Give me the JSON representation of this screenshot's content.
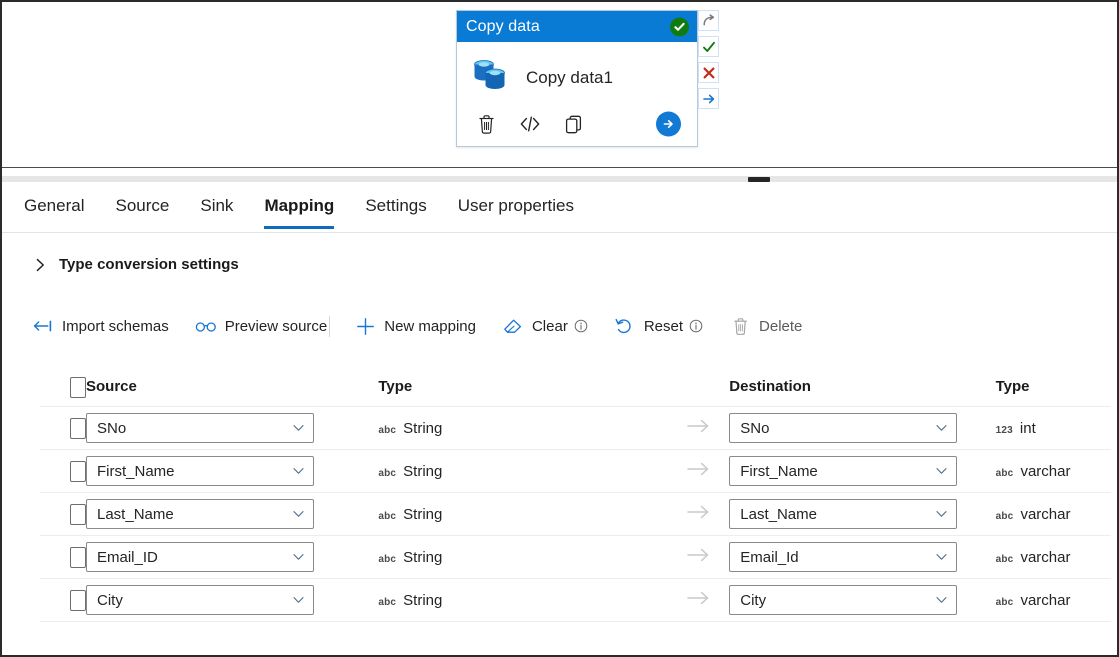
{
  "canvas": {
    "activity_card": {
      "header_title": "Copy data",
      "status_icon": "check-circle-icon",
      "activity_name": "Copy data1",
      "activity_icon": "copy-data-database-icon",
      "actions": [
        {
          "name": "delete-activity-button",
          "icon": "trash-icon"
        },
        {
          "name": "code-view-button",
          "icon": "code-brackets-icon"
        },
        {
          "name": "clone-activity-button",
          "icon": "duplicate-icon"
        },
        {
          "name": "run-activity-button",
          "icon": "arrow-right-circle-icon"
        }
      ]
    },
    "dependency_rail": [
      {
        "name": "dependency-skipped",
        "icon": "skip-arrow-icon",
        "color": "#7a7a7a"
      },
      {
        "name": "dependency-success",
        "icon": "check-icon",
        "color": "#107c10"
      },
      {
        "name": "dependency-failure",
        "icon": "cross-icon",
        "color": "#c42b1c"
      },
      {
        "name": "dependency-completion",
        "icon": "arrow-right-icon",
        "color": "#0f6cbd"
      }
    ]
  },
  "tabs": [
    {
      "label": "General",
      "active": false
    },
    {
      "label": "Source",
      "active": false
    },
    {
      "label": "Sink",
      "active": false
    },
    {
      "label": "Mapping",
      "active": true
    },
    {
      "label": "Settings",
      "active": false
    },
    {
      "label": "User properties",
      "active": false
    }
  ],
  "type_conversion": {
    "label": "Type conversion settings",
    "expanded": false,
    "chevron_icon": "chevron-right-icon"
  },
  "commandbar": [
    {
      "label": "Import schemas",
      "icon": "import-schemas-icon",
      "info": false
    },
    {
      "label": "Preview source",
      "icon": "glasses-icon",
      "info": false
    },
    {
      "label": "New mapping",
      "icon": "plus-icon",
      "info": false
    },
    {
      "label": "Clear",
      "icon": "eraser-icon",
      "info": true
    },
    {
      "label": "Reset",
      "icon": "undo-icon",
      "info": true
    },
    {
      "label": "Delete",
      "icon": "trash-icon",
      "info": false
    }
  ],
  "table": {
    "columns": {
      "source": "Source",
      "source_type": "Type",
      "destination": "Destination",
      "destination_type": "Type"
    },
    "rows": [
      {
        "checked": false,
        "source": "SNo",
        "source_type": "String",
        "source_type_prefix": "abc",
        "destination": "SNo",
        "destination_type": "int",
        "destination_type_prefix": "123"
      },
      {
        "checked": false,
        "source": "First_Name",
        "source_type": "String",
        "source_type_prefix": "abc",
        "destination": "First_Name",
        "destination_type": "varchar",
        "destination_type_prefix": "abc"
      },
      {
        "checked": false,
        "source": "Last_Name",
        "source_type": "String",
        "source_type_prefix": "abc",
        "destination": "Last_Name",
        "destination_type": "varchar",
        "destination_type_prefix": "abc"
      },
      {
        "checked": false,
        "source": "Email_ID",
        "source_type": "String",
        "source_type_prefix": "abc",
        "destination": "Email_Id",
        "destination_type": "varchar",
        "destination_type_prefix": "abc"
      },
      {
        "checked": false,
        "source": "City",
        "source_type": "String",
        "source_type_prefix": "abc",
        "destination": "City",
        "destination_type": "varchar",
        "destination_type_prefix": "abc"
      }
    ]
  },
  "colors": {
    "accent": "#0f6cbd",
    "card_header": "#0a7bd4",
    "success": "#107c10",
    "error": "#c42b1c"
  }
}
